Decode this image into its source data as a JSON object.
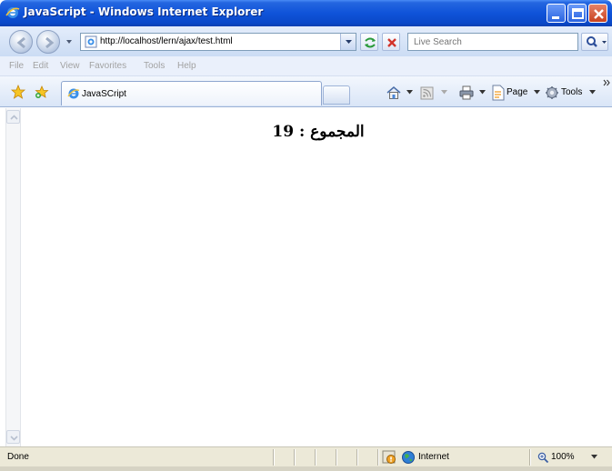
{
  "window": {
    "title": "JavaScript - Windows Internet Explorer"
  },
  "address_bar": {
    "url": "http://localhost/lern/ajax/test.html"
  },
  "search": {
    "placeholder": "Live Search"
  },
  "menu": {
    "items": [
      "File",
      "Edit",
      "View",
      "Favorites",
      "Tools",
      "Help"
    ]
  },
  "tabs": {
    "active_label": "JavaSCript"
  },
  "command_bar": {
    "page_label": "Page",
    "tools_label": "Tools"
  },
  "page": {
    "heading": "المجموع : 19"
  },
  "status_bar": {
    "status": "Done",
    "zone": "Internet",
    "zoom": "100%"
  },
  "colors": {
    "titlebar": "#0f53d9",
    "chrome": "#d9e5f7",
    "statusbar": "#ece9d8"
  },
  "icons": [
    "ie-logo-icon",
    "back-icon",
    "forward-icon",
    "refresh-icon",
    "stop-icon",
    "search-icon",
    "favorites-star-icon",
    "add-favorites-icon",
    "home-icon",
    "feeds-icon",
    "print-icon",
    "page-icon",
    "tools-gear-icon",
    "security-icon",
    "globe-icon",
    "zoom-icon"
  ]
}
